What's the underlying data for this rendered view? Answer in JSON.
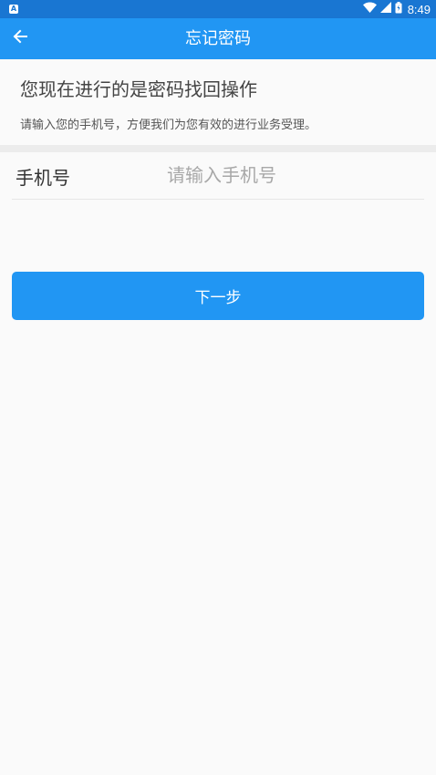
{
  "status_bar": {
    "app_icon_letter": "A",
    "time": "8:49",
    "icons": [
      "wifi-icon",
      "cell-signal-icon",
      "battery-icon"
    ]
  },
  "app_bar": {
    "title": "忘记密码",
    "back_icon": "arrow-left-icon"
  },
  "info": {
    "heading": "您现在进行的是密码找回操作",
    "description": "请输入您的手机号，方便我们为您有效的进行业务受理。"
  },
  "form": {
    "phone_label": "手机号",
    "phone_placeholder": "请输入手机号",
    "phone_value": ""
  },
  "actions": {
    "next_label": "下一步"
  },
  "colors": {
    "status_bar": "#1976d2",
    "primary": "#2196f3",
    "background": "#fafafa",
    "divider": "#ececec"
  }
}
